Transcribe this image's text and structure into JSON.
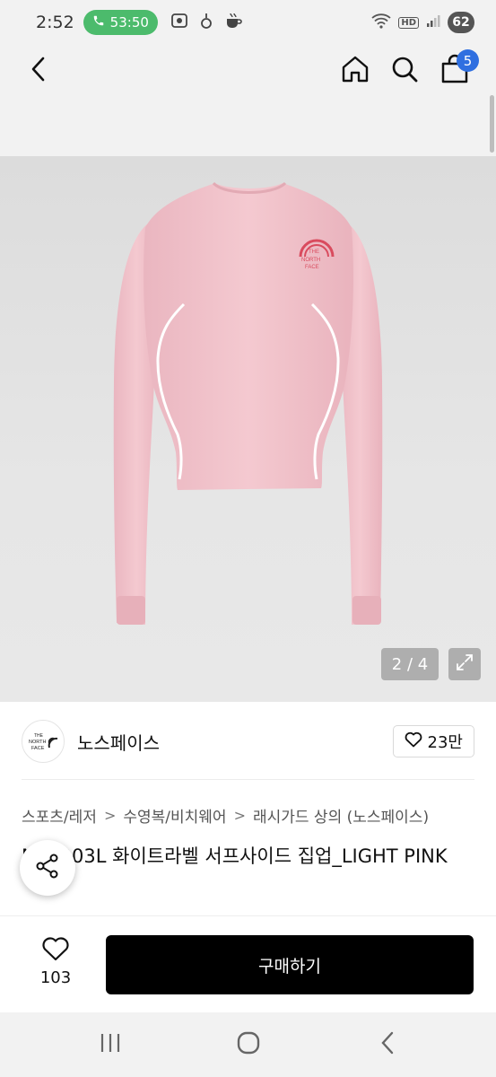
{
  "status_bar": {
    "time": "2:52",
    "call_timer": "53:50",
    "hd": "HD",
    "battery": "62",
    "icons_left": [
      "screenshot-icon",
      "notification-icon",
      "cafe-icon"
    ]
  },
  "nav": {
    "cart_count": "5",
    "icons": [
      "back-icon",
      "home-icon",
      "search-icon",
      "cart-icon"
    ]
  },
  "image": {
    "counter": "2 / 4",
    "logo_text": "THE NORTH FACE",
    "shirt_color": "#f2c3cb"
  },
  "store": {
    "name": "노스페이스",
    "likes": "23만"
  },
  "breadcrumb": [
    "스포츠/레저",
    "수영복/비치웨어",
    "래시가드 상의 (노스페이스)"
  ],
  "product": {
    "title": "NJ5JR03L 화이트라벨 서프사이드 집업_LIGHT PINK"
  },
  "bottom_bar": {
    "wish_count": "103",
    "buy_label": "구매하기"
  },
  "colors": {
    "accent": "#2f6fe0",
    "call_green": "#4cbb6c",
    "buy_button": "#000000"
  }
}
